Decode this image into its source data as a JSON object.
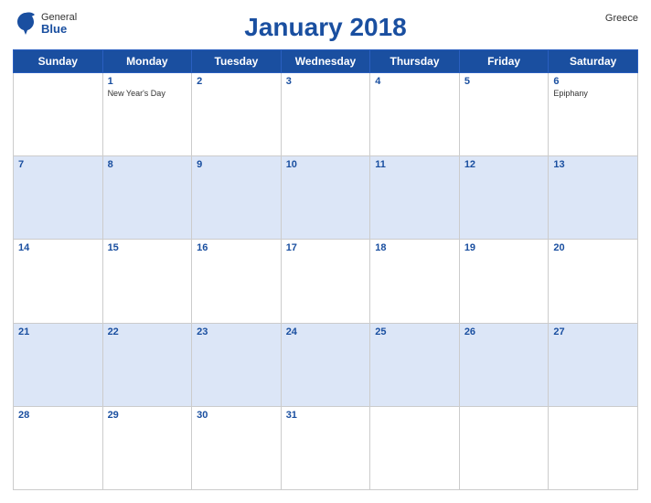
{
  "logo": {
    "general": "General",
    "blue": "Blue"
  },
  "title": "January 2018",
  "country": "Greece",
  "days_of_week": [
    "Sunday",
    "Monday",
    "Tuesday",
    "Wednesday",
    "Thursday",
    "Friday",
    "Saturday"
  ],
  "weeks": [
    [
      {
        "day": "",
        "holiday": ""
      },
      {
        "day": "1",
        "holiday": "New Year's Day"
      },
      {
        "day": "2",
        "holiday": ""
      },
      {
        "day": "3",
        "holiday": ""
      },
      {
        "day": "4",
        "holiday": ""
      },
      {
        "day": "5",
        "holiday": ""
      },
      {
        "day": "6",
        "holiday": "Epiphany"
      }
    ],
    [
      {
        "day": "7",
        "holiday": ""
      },
      {
        "day": "8",
        "holiday": ""
      },
      {
        "day": "9",
        "holiday": ""
      },
      {
        "day": "10",
        "holiday": ""
      },
      {
        "day": "11",
        "holiday": ""
      },
      {
        "day": "12",
        "holiday": ""
      },
      {
        "day": "13",
        "holiday": ""
      }
    ],
    [
      {
        "day": "14",
        "holiday": ""
      },
      {
        "day": "15",
        "holiday": ""
      },
      {
        "day": "16",
        "holiday": ""
      },
      {
        "day": "17",
        "holiday": ""
      },
      {
        "day": "18",
        "holiday": ""
      },
      {
        "day": "19",
        "holiday": ""
      },
      {
        "day": "20",
        "holiday": ""
      }
    ],
    [
      {
        "day": "21",
        "holiday": ""
      },
      {
        "day": "22",
        "holiday": ""
      },
      {
        "day": "23",
        "holiday": ""
      },
      {
        "day": "24",
        "holiday": ""
      },
      {
        "day": "25",
        "holiday": ""
      },
      {
        "day": "26",
        "holiday": ""
      },
      {
        "day": "27",
        "holiday": ""
      }
    ],
    [
      {
        "day": "28",
        "holiday": ""
      },
      {
        "day": "29",
        "holiday": ""
      },
      {
        "day": "30",
        "holiday": ""
      },
      {
        "day": "31",
        "holiday": ""
      },
      {
        "day": "",
        "holiday": ""
      },
      {
        "day": "",
        "holiday": ""
      },
      {
        "day": "",
        "holiday": ""
      }
    ]
  ],
  "row_classes": [
    "row-white",
    "row-blue",
    "row-white",
    "row-blue",
    "row-white"
  ]
}
